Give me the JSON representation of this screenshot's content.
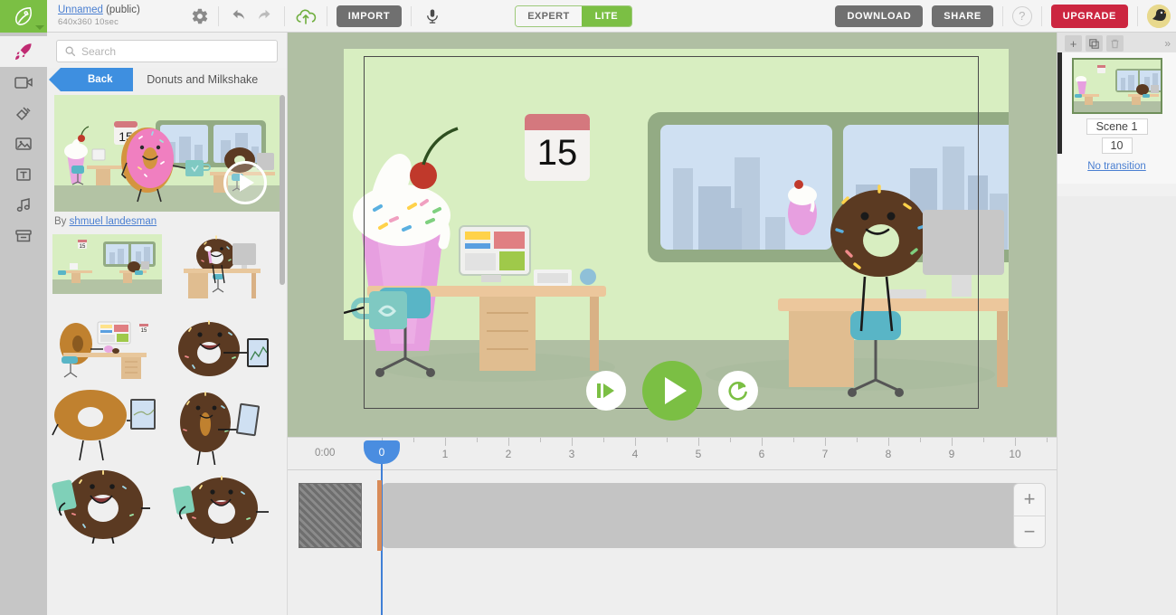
{
  "topbar": {
    "logo_icon": "leaf-logo-icon",
    "project_name": "Unnamed",
    "project_visibility": "(public)",
    "project_dims": "640x360  10sec",
    "gear_icon": "gear-icon",
    "undo_icon": "undo-arrow-icon",
    "redo_icon": "redo-arrow-icon",
    "upload_icon": "cloud-upload-icon",
    "import_label": "IMPORT",
    "mic_icon": "microphone-icon",
    "mode_expert": "EXPERT",
    "mode_lite": "LITE",
    "download_label": "DOWNLOAD",
    "share_label": "SHARE",
    "help_icon": "question-mark-icon",
    "help_label": "?",
    "upgrade_label": "UPGRADE",
    "avatar_icon": "user-avatar-bird-icon"
  },
  "rail": {
    "items": [
      {
        "name": "rocket",
        "label": "Templates"
      },
      {
        "name": "video-camera",
        "label": "Video"
      },
      {
        "name": "shapes",
        "label": "Props"
      },
      {
        "name": "image",
        "label": "Images"
      },
      {
        "name": "text",
        "label": "Text"
      },
      {
        "name": "music",
        "label": "Audio"
      },
      {
        "name": "archive",
        "label": "Background"
      }
    ],
    "active_index": 0
  },
  "library": {
    "search_placeholder": "Search",
    "search_value": "",
    "search_icon": "search-icon",
    "back_label": "Back",
    "category_title": "Donuts and Milkshake",
    "byline_prefix": "By",
    "author": "shmuel landesman",
    "hero_play_icon": "play-circle-icon",
    "assets": [
      {
        "name": "asset-office-scene-wide"
      },
      {
        "name": "asset-donut-at-desk-monitor"
      },
      {
        "name": "asset-donut-desk-presentation"
      },
      {
        "name": "asset-donut-tablet-chart"
      },
      {
        "name": "asset-plain-donut-tablet"
      },
      {
        "name": "asset-donut-phone-selfie"
      },
      {
        "name": "asset-donut-shouting-phone"
      },
      {
        "name": "asset-donut-phone-waving"
      }
    ]
  },
  "stage": {
    "calendar_day": "15",
    "play_icon": "play-icon",
    "step_icon": "play-from-start-icon",
    "restart_icon": "restart-icon",
    "backdrop_color": "#b0bfa3",
    "canvas_color": "#d8eec1"
  },
  "timeline": {
    "current_time": "0:00",
    "playhead_label": "0",
    "playhead_seconds": 0,
    "ruler_labels": [
      "1",
      "2",
      "3",
      "4",
      "5",
      "6",
      "7",
      "8",
      "9",
      "10"
    ],
    "zoom_in_label": "+",
    "zoom_out_label": "−",
    "zoom_in_icon": "plus-icon",
    "zoom_out_icon": "minus-icon",
    "thumb_name": "scene-thumbnail-placeholder",
    "clip_name": "scene-clip-bar"
  },
  "scenes": {
    "add_icon": "plus-icon",
    "duplicate_icon": "duplicate-icon",
    "delete_icon": "trash-icon",
    "collapse_icon": "double-chevron-right-icon",
    "scene_label": "Scene 1",
    "scene_duration": "10",
    "transition_label": "No transition"
  },
  "colors": {
    "brand_green": "#7bbf44",
    "accent_blue": "#3e8fe0",
    "upgrade_red": "#cc2640",
    "link_blue": "#4a7fd1"
  }
}
